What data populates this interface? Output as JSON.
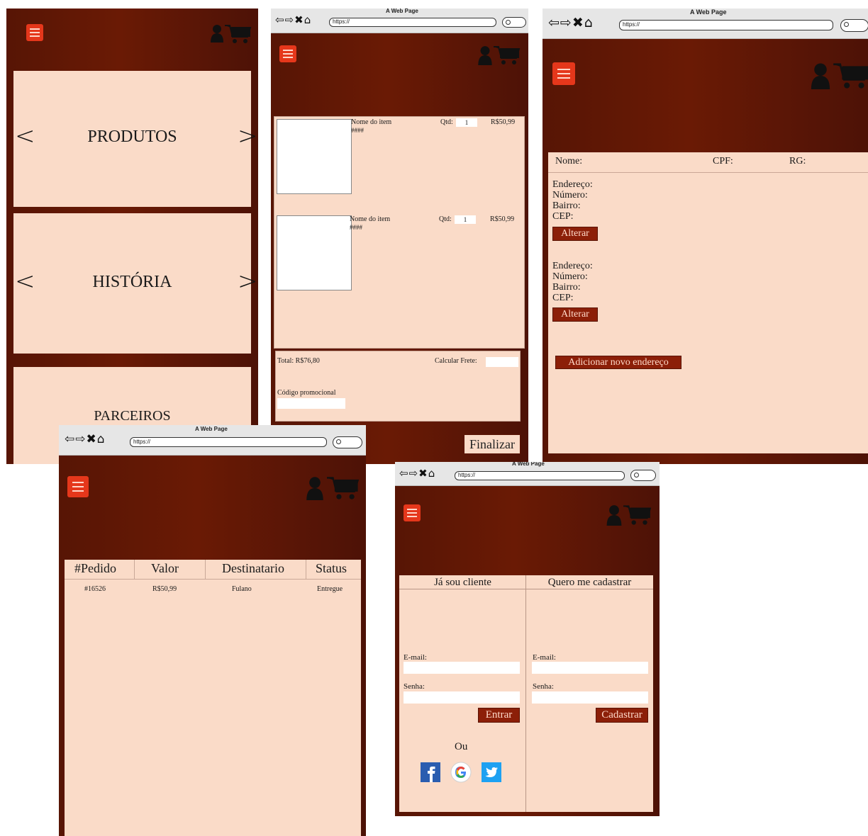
{
  "browser": {
    "title": "A Web Page",
    "url": "https://"
  },
  "home": {
    "sections": [
      {
        "label": "PRODUTOS"
      },
      {
        "label": "HISTÓRIA"
      },
      {
        "label": "PARCEIROS"
      }
    ]
  },
  "cart": {
    "items": [
      {
        "name": "Nome do item",
        "code": "####",
        "qty_label": "Qtd:",
        "qty": "1",
        "price": "R$50,99"
      },
      {
        "name": "Nome do item",
        "code": "####",
        "qty_label": "Qtd:",
        "qty": "1",
        "price": "R$50,99"
      }
    ],
    "total": "Total: R$76,80",
    "shipping_label": "Calcular Frete:",
    "promo_label": "Código promocional",
    "finish_button": "Finalizar"
  },
  "profile": {
    "name_label": "Nome:",
    "cpf_label": "CPF:",
    "rg_label": "RG:",
    "addresses": [
      {
        "street": "Endereço:",
        "number": "Número:",
        "district": "Bairro:",
        "cep": "CEP:",
        "button": "Alterar"
      },
      {
        "street": "Endereço:",
        "number": "Número:",
        "district": "Bairro:",
        "cep": "CEP:",
        "button": "Alterar"
      }
    ],
    "add_button": "Adicionar novo endereço"
  },
  "orders": {
    "headers": [
      "#Pedido",
      "Valor",
      "Destinatario",
      "Status"
    ],
    "rows": [
      {
        "id": "#16526",
        "value": "R$50,99",
        "recipient": "Fulano",
        "status": "Entregue"
      }
    ]
  },
  "login": {
    "client_tab": "Já sou cliente",
    "register_tab": "Quero me cadastrar",
    "email_label": "E-mail:",
    "password_label": "Senha:",
    "login_button": "Entrar",
    "register_button": "Cadastrar",
    "or_label": "Ou"
  },
  "colors": {
    "header_dark": "#5e1605",
    "panel": "#fadbc8",
    "menu_button": "#e5371b",
    "action_button": "#8c1f08"
  }
}
